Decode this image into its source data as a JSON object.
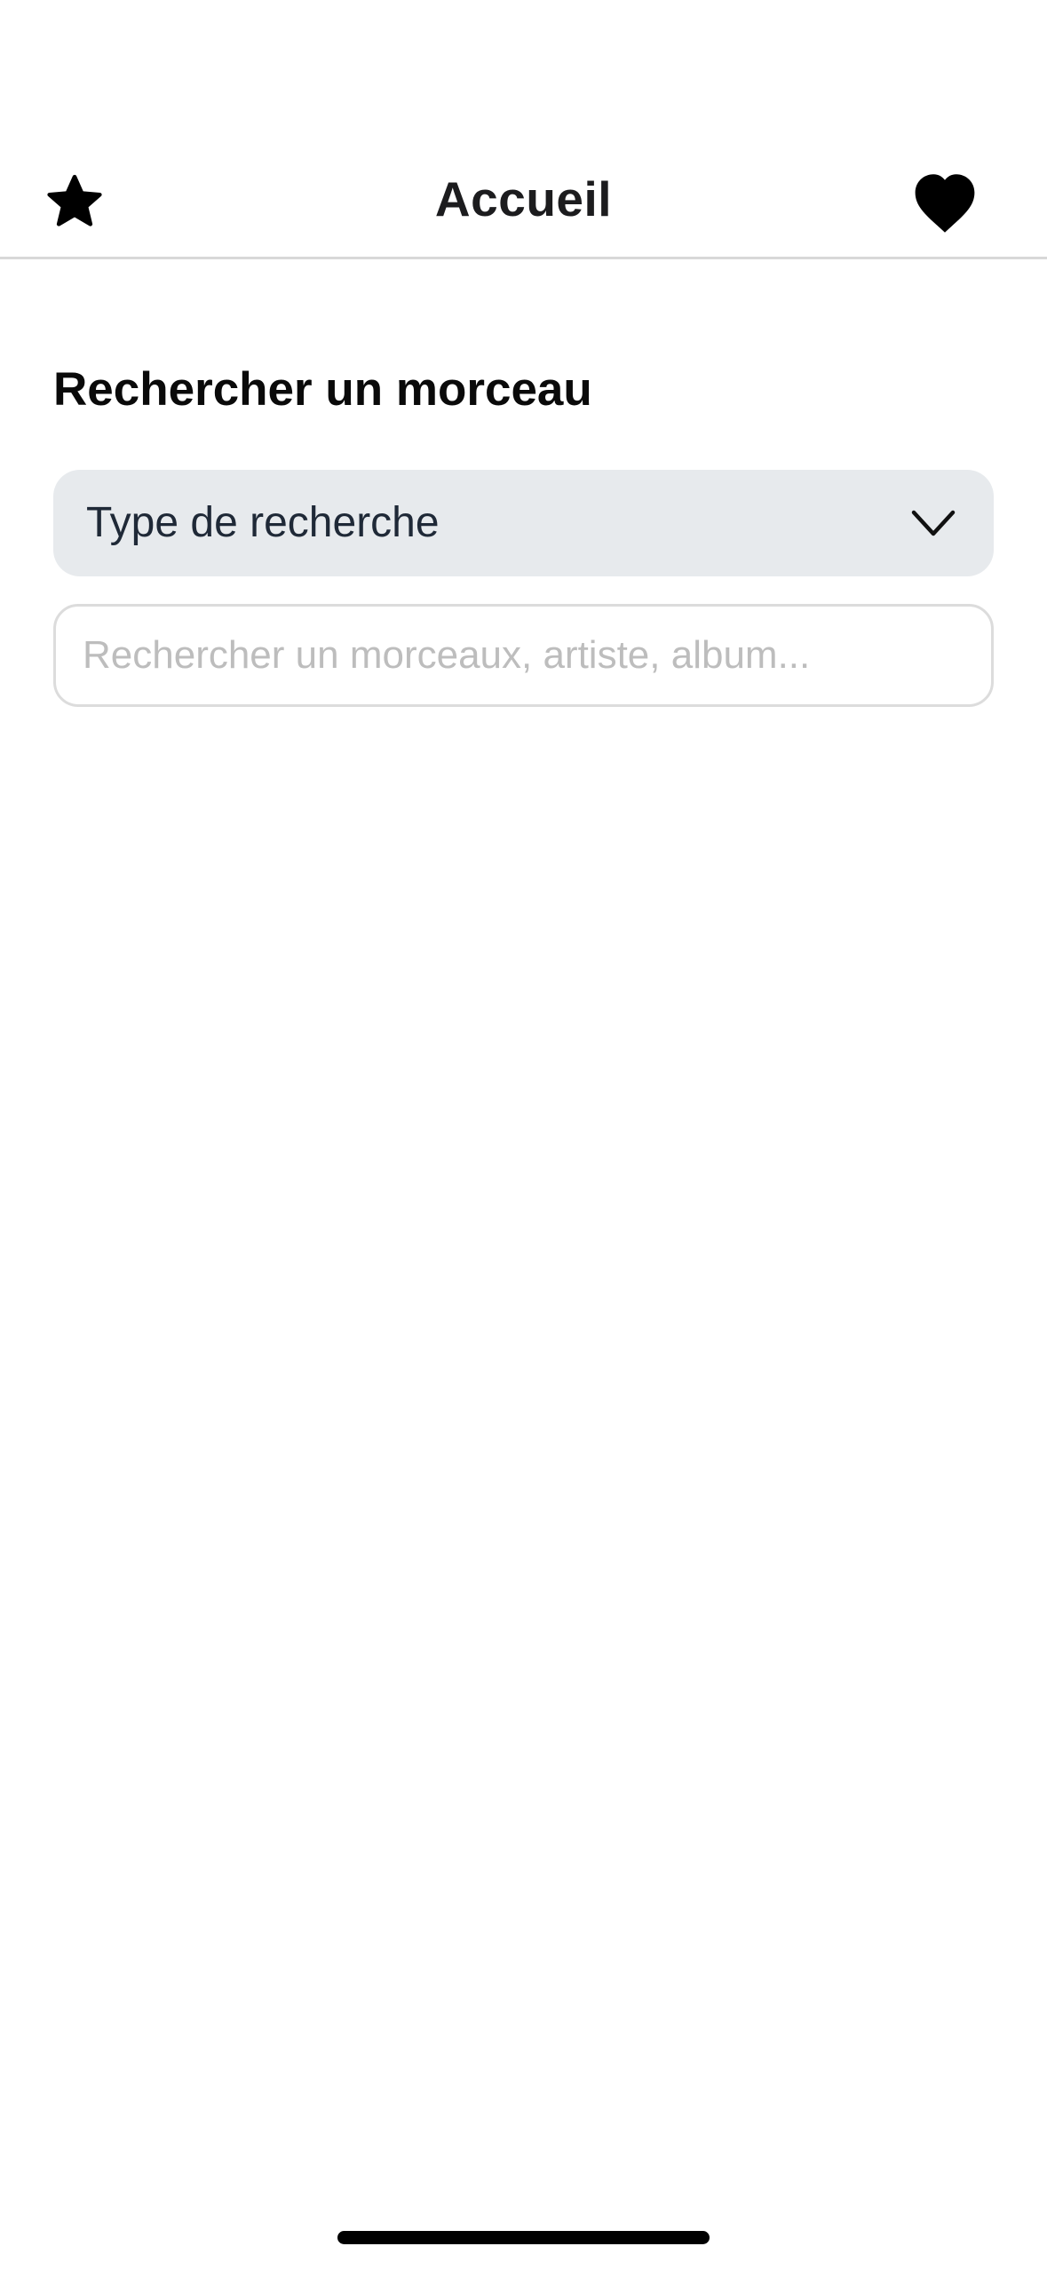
{
  "header": {
    "title": "Accueil",
    "left_icon": "star-icon",
    "right_icon": "heart-icon"
  },
  "main": {
    "section_title": "Rechercher un morceau",
    "search_type": {
      "selected_label": "Type de recherche",
      "icon": "chevron-down-icon"
    },
    "search": {
      "value": "",
      "placeholder": "Rechercher un morceaux, artiste, album..."
    }
  },
  "colors": {
    "background": "#ffffff",
    "select_background": "#e7eaed",
    "input_border": "#dcdcdc",
    "placeholder": "#bdbdbd",
    "icon": "#000000"
  }
}
